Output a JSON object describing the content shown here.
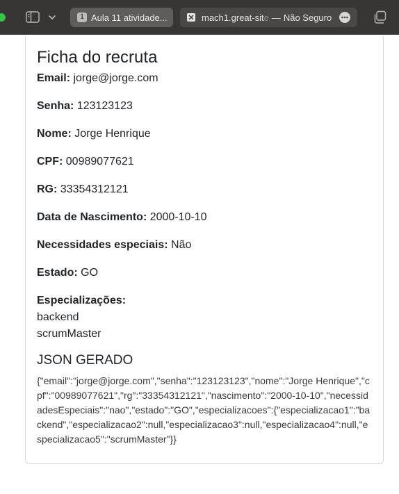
{
  "browser": {
    "tabs": [
      {
        "number": "1",
        "title": "Aula 11 atividade..."
      },
      {
        "host_main": "mach1.great-sit",
        "host_faded": "e",
        "separator": "—",
        "security": "Não Seguro"
      }
    ]
  },
  "page": {
    "title": "Ficha do recruta",
    "fields": [
      {
        "label": "Email:",
        "value": "jorge@jorge.com"
      },
      {
        "label": "Senha:",
        "value": "123123123"
      },
      {
        "label": "Nome:",
        "value": "Jorge Henrique"
      },
      {
        "label": "CPF:",
        "value": "00989077621"
      },
      {
        "label": "RG:",
        "value": "33354312121"
      },
      {
        "label": "Data de Nascimento:",
        "value": "2000-10-10"
      },
      {
        "label": "Necessidades especiais:",
        "value": "Não"
      },
      {
        "label": "Estado:",
        "value": "GO"
      }
    ],
    "specializations": {
      "label": "Especializações:",
      "items": [
        "backend",
        "scrumMaster"
      ]
    },
    "json_section": {
      "title": "JSON GERADO",
      "text": "{\"email\":\"jorge@jorge.com\",\"senha\":\"123123123\",\"nome\":\"Jorge Henrique\",\"cpf\":\"00989077621\",\"rg\":\"33354312121\",\"nascimento\":\"2000-10-10\",\"necessidadesEspeciais\":\"nao\",\"estado\":\"GO\",\"especializacoes\":{\"especializacao1\":\"backend\",\"especializacao2\":null,\"especializacao3\":null,\"especializacao4\":null,\"especializacao5\":\"scrumMaster\"}}"
    }
  },
  "colors": {
    "toolbar": "#383634",
    "active_tab": "#5f5d5b",
    "inactive_tab": "#4a4846",
    "traffic_green": "#2fc840",
    "text": "#212529",
    "card_border": "#d9d9d9"
  }
}
